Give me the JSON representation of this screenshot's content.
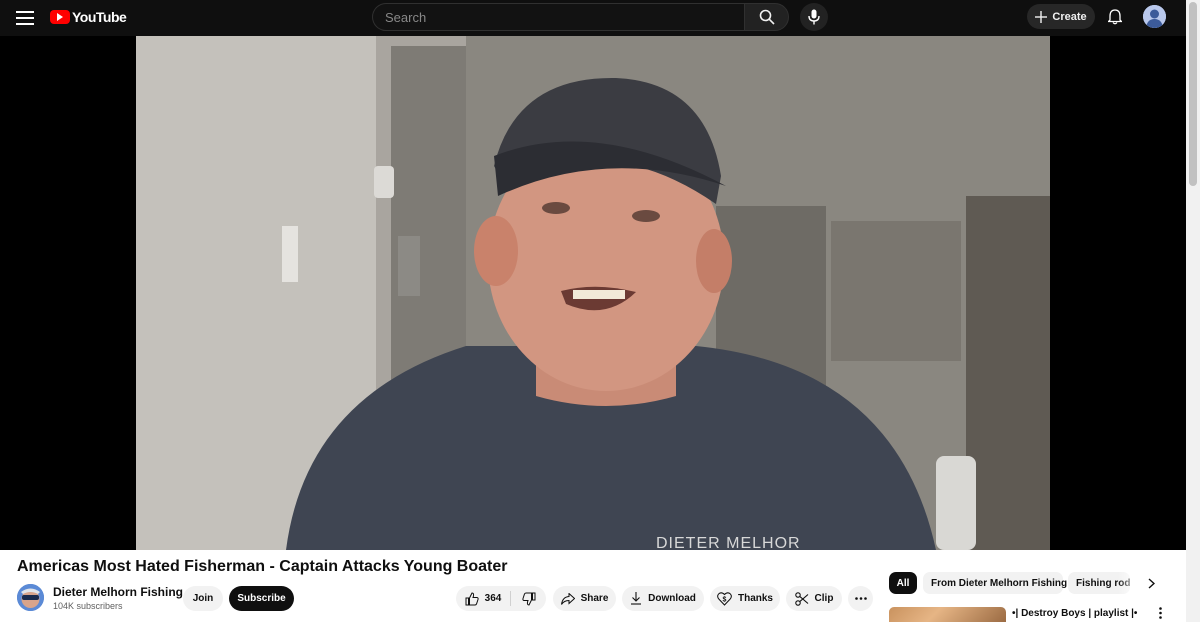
{
  "masthead": {
    "logo_text": "YouTube",
    "search_placeholder": "Search",
    "create_label": "Create"
  },
  "video": {
    "title": "Americas Most Hated Fisherman - Captain Attacks Young Boater",
    "shirt_text": "DIETER MELHOR"
  },
  "channel": {
    "name": "Dieter Melhorn Fishing",
    "subscribers": "104K subscribers",
    "join_label": "Join",
    "subscribe_label": "Subscribe"
  },
  "actions": {
    "like_count": "364",
    "share_label": "Share",
    "download_label": "Download",
    "thanks_label": "Thanks",
    "clip_label": "Clip"
  },
  "chips": [
    "All",
    "From Dieter Melhorn Fishing",
    "Fishing rods"
  ],
  "recommendation": {
    "title": "•| Destroy Boys | playlist |•"
  },
  "icons": {
    "menu": "hamburger-icon",
    "search": "search-icon",
    "mic": "mic-icon",
    "create": "plus-icon",
    "notifications": "bell-icon",
    "like": "thumbs-up-icon",
    "dislike": "thumbs-down-icon",
    "share": "share-arrow-icon",
    "download": "download-icon",
    "thanks": "heart-dollar-icon",
    "clip": "scissors-icon",
    "more": "more-horizontal-icon"
  },
  "colors": {
    "brand_red": "#ff0000",
    "masthead_bg": "#0f0f0f",
    "subscribe_bg": "#0f0f0f",
    "chip_bg": "#f2f2f2"
  }
}
